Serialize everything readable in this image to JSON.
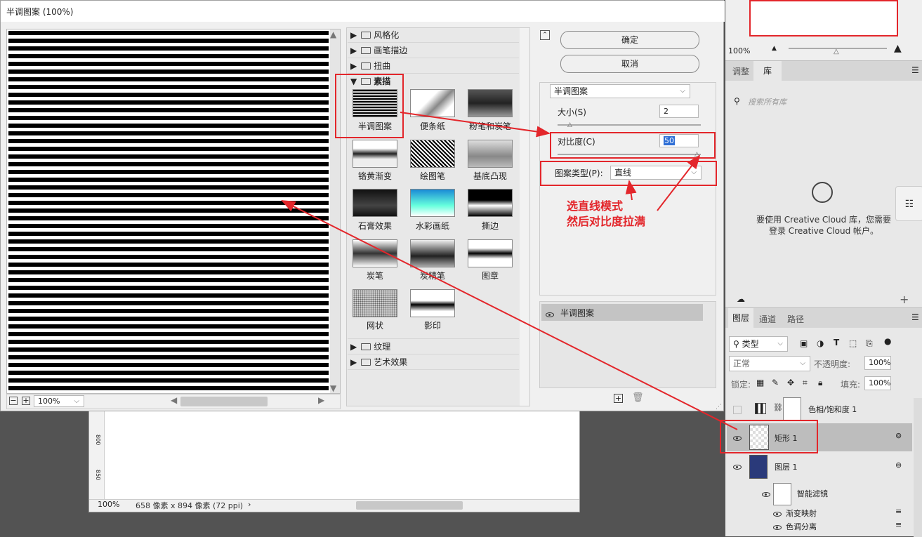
{
  "dialog": {
    "title": "半调图案 (100%)",
    "zoom": "100%",
    "ok_label": "确定",
    "cancel_label": "取消"
  },
  "categories": {
    "top": [
      {
        "label": "风格化"
      },
      {
        "label": "画笔描边"
      },
      {
        "label": "扭曲"
      }
    ],
    "open": {
      "label": "素描"
    },
    "bottom": [
      {
        "label": "纹理"
      },
      {
        "label": "艺术效果"
      }
    ]
  },
  "filters": [
    {
      "label": "半调图案"
    },
    {
      "label": "便条纸"
    },
    {
      "label": "粉笔和炭笔"
    },
    {
      "label": "铬黄渐变"
    },
    {
      "label": "绘图笔"
    },
    {
      "label": "基底凸现"
    },
    {
      "label": "石膏效果"
    },
    {
      "label": "水彩画纸"
    },
    {
      "label": "撕边"
    },
    {
      "label": "炭笔"
    },
    {
      "label": "炭精笔"
    },
    {
      "label": "图章"
    },
    {
      "label": "网状"
    },
    {
      "label": "影印"
    }
  ],
  "settings": {
    "filter_select": "半调图案",
    "size_label": "大小(S)",
    "size_value": "2",
    "contrast_label": "对比度(C)",
    "contrast_value": "50",
    "pattern_label": "图案类型(P):",
    "pattern_value": "直线"
  },
  "annotation": {
    "line1": "选直线模式",
    "line2": "然后对比度拉满"
  },
  "effect_layer": "半调图案",
  "doc": {
    "zoom": "100%",
    "info": "658 像素 x 894 像素 (72 ppi)",
    "ruler_a": "800",
    "ruler_b": "850"
  },
  "navigator": {
    "zoom": "100%"
  },
  "library": {
    "tabs": [
      "调整",
      "库"
    ],
    "search_placeholder": "搜索所有库",
    "message": "要使用 Creative Cloud 库，您需要登录 Creative Cloud 帐户。"
  },
  "layers": {
    "tabs": [
      "图层",
      "通道",
      "路径"
    ],
    "filter_kind": "类型",
    "blend_mode": "正常",
    "opacity_label": "不透明度:",
    "opacity_value": "100%",
    "lock_label": "锁定:",
    "fill_label": "填充:",
    "fill_value": "100%",
    "items": [
      {
        "name": "色相/饱和度 1"
      },
      {
        "name": "矩形 1"
      },
      {
        "name": "图层 1"
      }
    ],
    "smart_filter_label": "智能滤镜",
    "smart_filters": [
      "渐变映射",
      "色调分离"
    ]
  },
  "colors": {
    "accent_red": "#e3262b",
    "dialog_bg": "#f0f0f0",
    "panel_bg": "#e8e8e8"
  }
}
